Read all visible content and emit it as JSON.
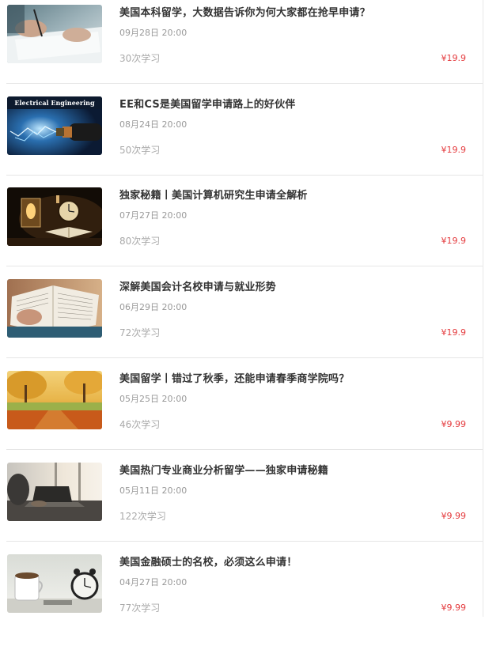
{
  "courses": [
    {
      "title": "美国本科留学，大数据告诉你为何大家都在抢早申请？",
      "date": "09月28日 20:00",
      "learners": "30次学习",
      "price": "¥19.9",
      "image": "writing-hand-photo"
    },
    {
      "title": "EE和CS是美国留学申请路上的好伙伴",
      "date": "08月24日 20:00",
      "learners": "50次学习",
      "price": "¥19.9",
      "image": "electric-cable-photo",
      "image_caption": "Electrical Engineering"
    },
    {
      "title": "独家秘籍丨美国计算机研究生申请全解析",
      "date": "07月27日 20:00",
      "learners": "80次学习",
      "price": "¥19.9",
      "image": "clock-candle-book-photo"
    },
    {
      "title": "深解美国会计名校申请与就业形势",
      "date": "06月29日 20:00",
      "learners": "72次学习",
      "price": "¥19.9",
      "image": "open-book-photo"
    },
    {
      "title": "美国留学丨错过了秋季，还能申请春季商学院吗？",
      "date": "05月25日 20:00",
      "learners": "46次学习",
      "price": "¥9.99",
      "image": "autumn-park-photo"
    },
    {
      "title": "美国热门专业商业分析留学——独家申请秘籍",
      "date": "05月11日 20:00",
      "learners": "122次学习",
      "price": "¥9.99",
      "image": "laptop-window-photo"
    },
    {
      "title": "美国金融硕士的名校，必须这么申请！",
      "date": "04月27日 20:00",
      "learners": "77次学习",
      "price": "¥9.99",
      "image": "coffee-clock-photo"
    }
  ]
}
